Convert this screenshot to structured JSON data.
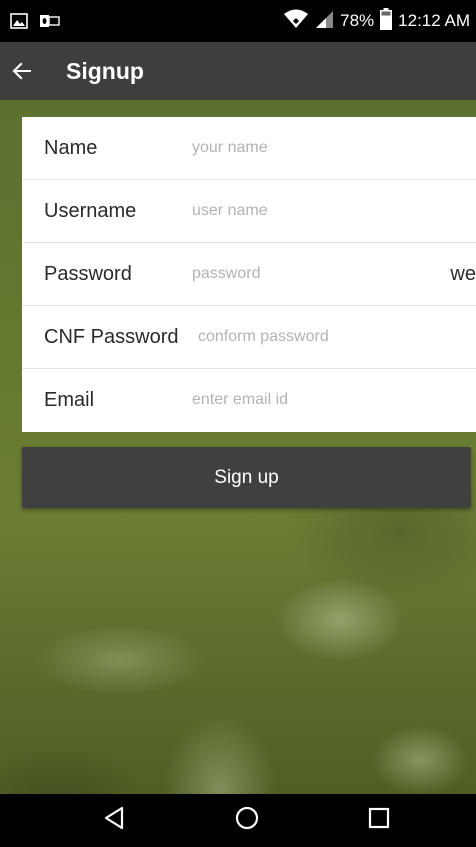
{
  "status_bar": {
    "battery": "78%",
    "time": "12:12 AM",
    "icons": [
      "image-notification-icon",
      "outlook-notification-icon",
      "wifi-icon",
      "signal-icon",
      "battery-icon"
    ]
  },
  "app_bar": {
    "title": "Signup",
    "back_icon": "arrow-left-icon"
  },
  "form": {
    "fields": [
      {
        "label": "Name",
        "placeholder": "your name",
        "value": ""
      },
      {
        "label": "Username",
        "placeholder": "user name",
        "value": ""
      },
      {
        "label": "Password",
        "placeholder": "password",
        "value": "",
        "extra": "we"
      },
      {
        "label": "CNF Password",
        "placeholder": "conform password",
        "value": ""
      },
      {
        "label": "Email",
        "placeholder": "enter email id",
        "value": ""
      }
    ]
  },
  "signup_button": {
    "label": "Sign up"
  },
  "nav_bar": {
    "icons": [
      "back-triangle-icon",
      "home-circle-icon",
      "recents-square-icon"
    ]
  },
  "colors": {
    "app_bar": "#3e3e3e",
    "button": "#404040",
    "background_green": "#64782f"
  }
}
